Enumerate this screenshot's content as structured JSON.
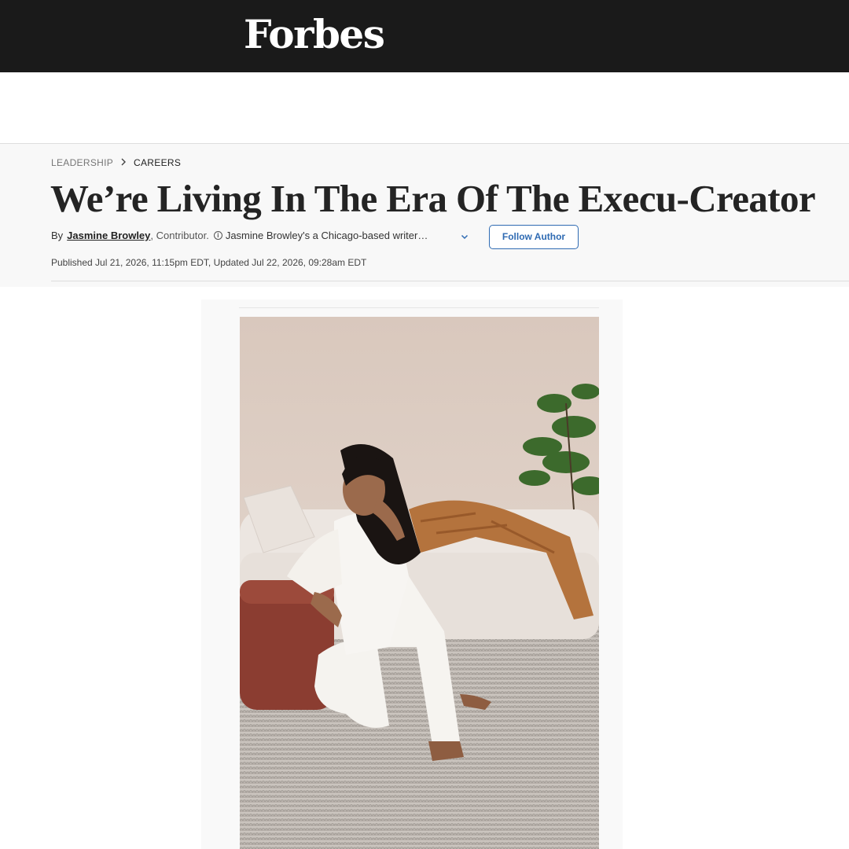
{
  "header": {
    "logo": "Forbes"
  },
  "breadcrumb": {
    "section": "LEADERSHIP",
    "subsection": "CAREERS"
  },
  "article": {
    "headline": "We’re Living In The Era Of The Execu-Creator",
    "byline": {
      "by": "By",
      "author": "Jasmine Browley",
      "role": ", Contributor.",
      "bio": "Jasmine Browley's a Chicago-based writer…",
      "follow_label": "Follow Author"
    },
    "dates": "Published Jul 21, 2026, 11:15pm EDT, Updated Jul 22, 2026, 09:28am EDT"
  },
  "colors": {
    "topbar": "#1a1a1a",
    "accent": "#2f6bb3",
    "header_bg": "#f8f8f8"
  },
  "icons": {
    "info": "info-icon",
    "chevron": "chevron-down-icon",
    "crumb_sep": "chevron-right-icon"
  }
}
